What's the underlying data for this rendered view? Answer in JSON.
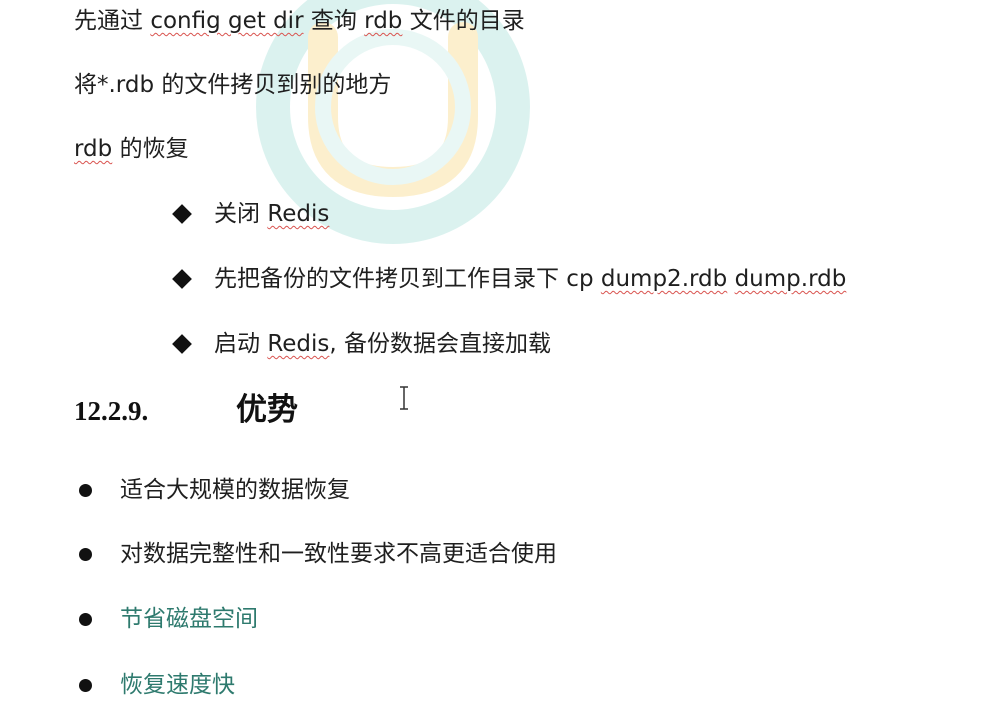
{
  "intro": {
    "line1": {
      "pre": "先通过 ",
      "cmd": "config get dir",
      "mid": "  查询 ",
      "rdb": "rdb",
      "post": " 文件的目录"
    },
    "line2": {
      "pre": "将",
      "file": "*.rdb",
      "post": " 的文件拷贝到别的地方"
    },
    "line3": {
      "rdb": "rdb",
      "post": " 的恢复"
    }
  },
  "restore_steps": [
    {
      "pre": "关闭 ",
      "word": "Redis",
      "post": ""
    },
    {
      "pre": "先把备份的文件拷贝到工作目录下 cp ",
      "word": "dump2.rdb",
      "mid": " ",
      "word2": "dump.rdb"
    },
    {
      "pre": "启动 ",
      "word": "Redis",
      "post": ", 备份数据会直接加载"
    }
  ],
  "section": {
    "number": "12.2.9.",
    "title": "优势"
  },
  "advantages": [
    "适合大规模的数据恢复",
    "对数据完整性和一致性要求不高更适合使用",
    "节省磁盘空间",
    "恢复速度快"
  ],
  "colors": {
    "text": "#1f1f1f",
    "highlight_teal": "#2e7a6e",
    "spellcheck_underline": "#d9534f"
  },
  "icons": {
    "cursor": "text-cursor-icon",
    "watermark": "brand-logo-watermark"
  }
}
